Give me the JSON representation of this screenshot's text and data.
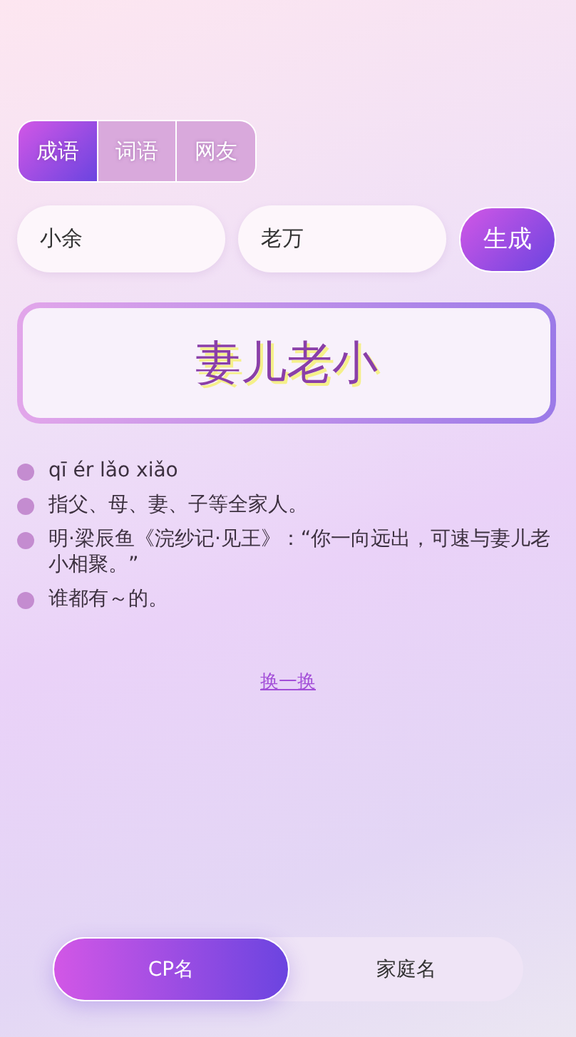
{
  "tabs": [
    {
      "label": "成语",
      "selected": true
    },
    {
      "label": "词语",
      "selected": false
    },
    {
      "label": "网友",
      "selected": false
    }
  ],
  "inputs": [
    {
      "value": "小余"
    },
    {
      "value": "老万"
    }
  ],
  "generate_button": "生成",
  "result": "妻儿老小",
  "details": [
    "qī ér lǎo xiǎo",
    "指父、母、妻、子等全家人。",
    "明·梁辰鱼《浣纱记·见王》：“你一向远出，可速与妻儿老小相聚。”",
    "谁都有～的。"
  ],
  "refresh_link": "换一换",
  "modes": [
    {
      "label": "CP名",
      "selected": true
    },
    {
      "label": "家庭名",
      "selected": false
    }
  ]
}
